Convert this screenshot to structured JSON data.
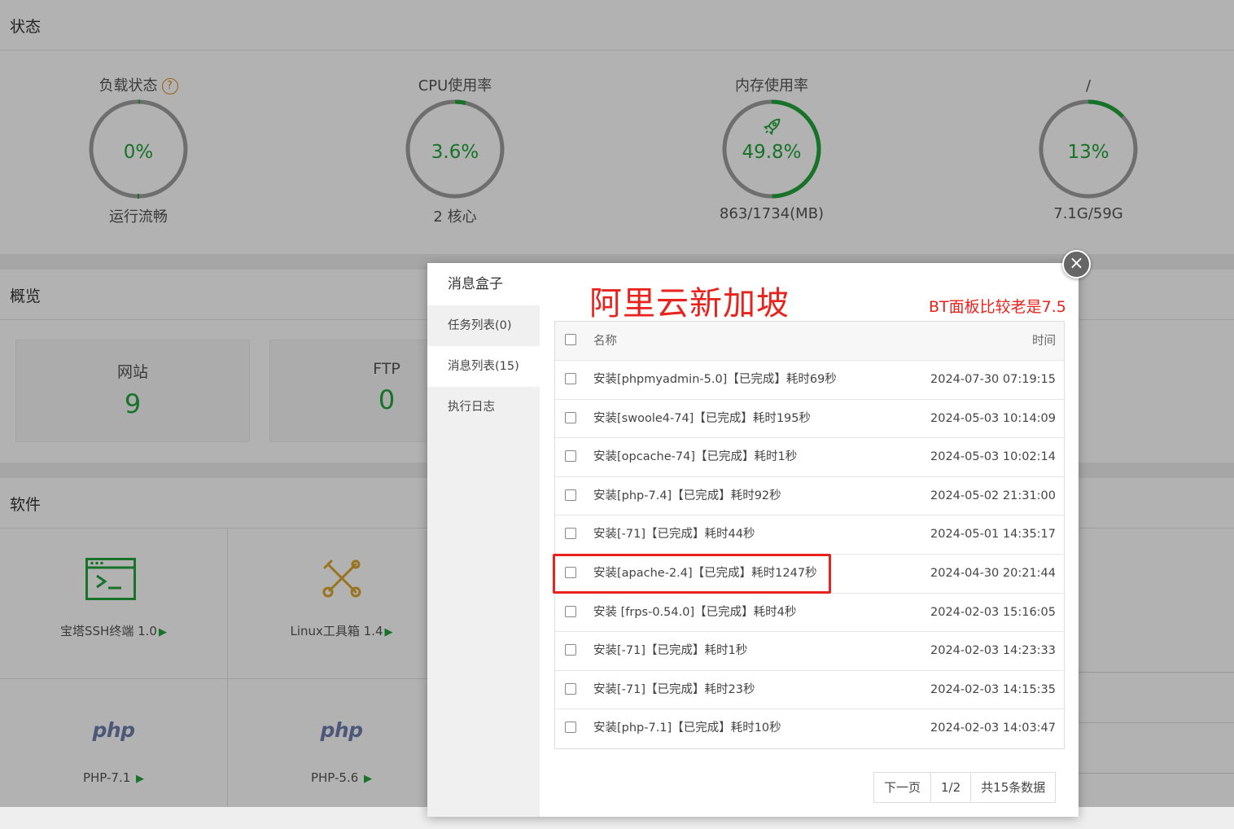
{
  "status": {
    "title": "状态",
    "gauges": [
      {
        "title": "负载状态",
        "help": "?",
        "value": "0%",
        "percent": 0,
        "sub": "运行流畅"
      },
      {
        "title": "CPU使用率",
        "value": "3.6%",
        "percent": 3.6,
        "sub": "2 核心"
      },
      {
        "title": "内存使用率",
        "value": "49.8%",
        "percent": 49.8,
        "sub": "863/1734(MB)"
      },
      {
        "title": "/",
        "value": "13%",
        "percent": 13,
        "sub": "7.1G/59G"
      }
    ]
  },
  "overview": {
    "title": "概览",
    "cards": [
      {
        "label": "网站",
        "value": "9"
      },
      {
        "label": "FTP",
        "value": "0"
      }
    ]
  },
  "software": {
    "title": "软件",
    "items": [
      {
        "label": "宝塔SSH终端 1.0",
        "arrow": "▶",
        "icon": "terminal-icon"
      },
      {
        "label": "Linux工具箱 1.4",
        "arrow": "▶",
        "icon": "tools-icon"
      },
      {
        "label": "PHP-7.1",
        "arrow": "▶",
        "logo": "php"
      },
      {
        "label": "PHP-5.6",
        "arrow": "▶",
        "logo": "php"
      }
    ]
  },
  "dialog": {
    "title": "消息盒子",
    "close": "×",
    "tabs": [
      {
        "label": "任务列表(0)"
      },
      {
        "label": "消息列表(15)"
      },
      {
        "label": "执行日志"
      }
    ],
    "header": {
      "name": "名称",
      "time": "时间"
    },
    "rows": [
      {
        "name": "安装[phpmyadmin-5.0]【已完成】耗时69秒",
        "time": "2024-07-30 07:19:15"
      },
      {
        "name": "安装[swoole4-74]【已完成】耗时195秒",
        "time": "2024-05-03 10:14:09"
      },
      {
        "name": "安装[opcache-74]【已完成】耗时1秒",
        "time": "2024-05-03 10:02:14"
      },
      {
        "name": "安装[php-7.4]【已完成】耗时92秒",
        "time": "2024-05-02 21:31:00"
      },
      {
        "name": "安装[-71]【已完成】耗时44秒",
        "time": "2024-05-01 14:35:17"
      },
      {
        "name": "安装[apache-2.4]【已完成】耗时1247秒",
        "time": "2024-04-30 20:21:44"
      },
      {
        "name": "安装 [frps-0.54.0]【已完成】耗时4秒",
        "time": "2024-02-03 15:16:05"
      },
      {
        "name": "安装[-71]【已完成】耗时1秒",
        "time": "2024-02-03 14:23:33"
      },
      {
        "name": "安装[-71]【已完成】耗时23秒",
        "time": "2024-02-03 14:15:35"
      },
      {
        "name": "安装[php-7.1]【已完成】耗时10秒",
        "time": "2024-02-03 14:03:47"
      }
    ],
    "pager": {
      "next": "下一页",
      "page": "1/2",
      "total": "共15条数据"
    }
  },
  "annotations": {
    "big": "阿里云新加坡",
    "small": "BT面板比较老是7.5"
  },
  "colors": {
    "accent": "#20a53a",
    "annotation": "#e8231d",
    "ring": "#9e9e9e"
  }
}
